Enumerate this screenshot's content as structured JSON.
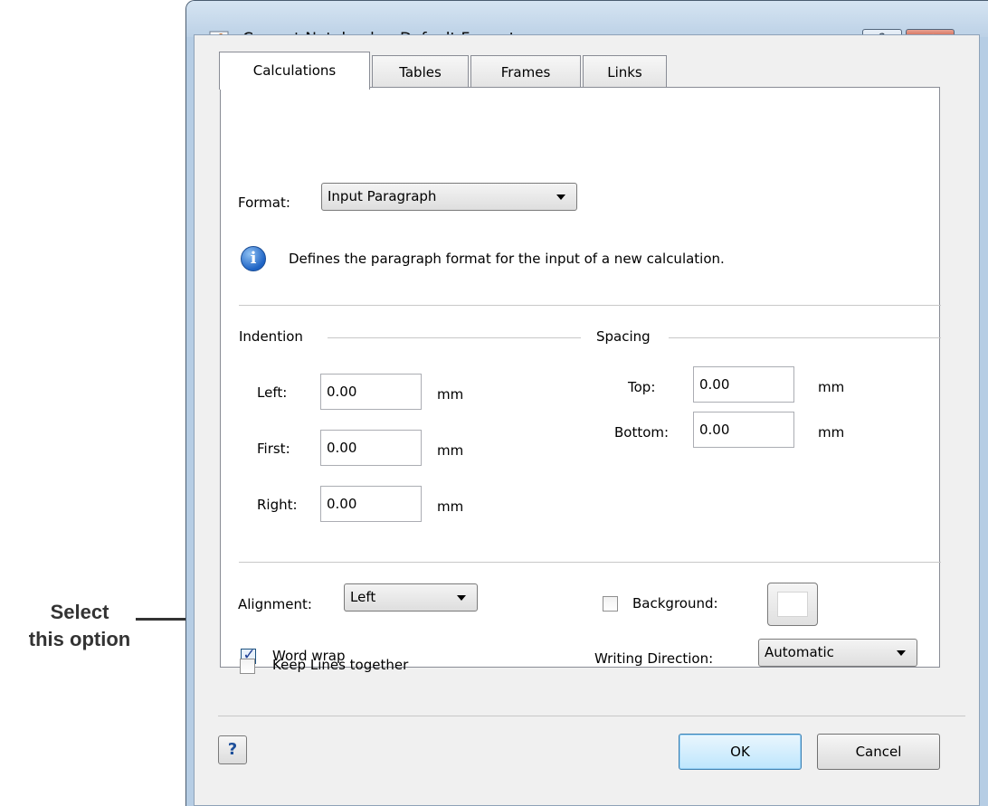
{
  "callout": {
    "line1": "Select",
    "line2": "this option"
  },
  "window": {
    "title": "Current Notebook -- Default Formats",
    "help_glyph": "?",
    "close_glyph": "✕"
  },
  "tabs": [
    {
      "label": "Calculations",
      "active": true
    },
    {
      "label": "Tables",
      "active": false
    },
    {
      "label": "Frames",
      "active": false
    },
    {
      "label": "Links",
      "active": false
    }
  ],
  "format": {
    "label": "Format:",
    "value": "Input Paragraph",
    "description": "Defines the paragraph format for the input of a new calculation."
  },
  "indention": {
    "heading": "Indention",
    "left": {
      "label": "Left:",
      "value": "0.00",
      "unit": "mm"
    },
    "first": {
      "label": "First:",
      "value": "0.00",
      "unit": "mm"
    },
    "right": {
      "label": "Right:",
      "value": "0.00",
      "unit": "mm"
    }
  },
  "spacing": {
    "heading": "Spacing",
    "top": {
      "label": "Top:",
      "value": "0.00",
      "unit": "mm"
    },
    "bottom": {
      "label": "Bottom:",
      "value": "0.00",
      "unit": "mm"
    }
  },
  "alignment": {
    "label": "Alignment:",
    "value": "Left"
  },
  "background": {
    "label": "Background:",
    "checked": false,
    "color": "#ffffff"
  },
  "word_wrap": {
    "label": "Word wrap",
    "checked": true,
    "check_glyph": "✓"
  },
  "keep_lines": {
    "label": "Keep Lines together",
    "checked": false
  },
  "writing_direction": {
    "label": "Writing Direction:",
    "value": "Automatic"
  },
  "buttons": {
    "ok": "OK",
    "cancel": "Cancel",
    "context_help_glyph": "?"
  },
  "colors": {
    "titlebar": "#bcd1e6",
    "close_button": "#c4482f",
    "info_icon": "#1e63c4"
  }
}
